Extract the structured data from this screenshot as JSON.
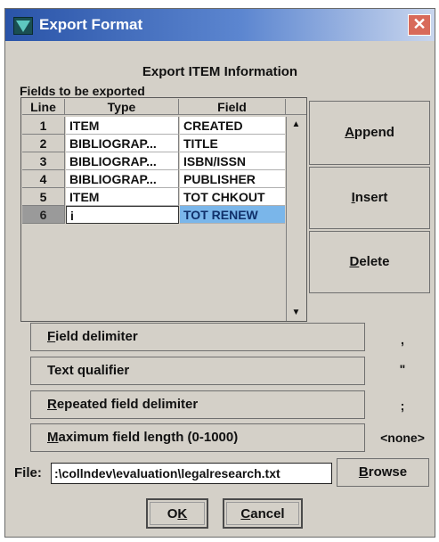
{
  "window": {
    "title": "Export Format",
    "close_glyph": "✕",
    "colors": {
      "titlebar_start": "#2a54a8",
      "titlebar_end": "#c9d6ee",
      "body": "#d4d0c8"
    }
  },
  "heading": "Export ITEM Information",
  "fields_label": "Fields to be exported",
  "table": {
    "columns": [
      "Line",
      "Type",
      "Field"
    ],
    "rows": [
      {
        "line": "1",
        "type": "ITEM",
        "field": "CREATED"
      },
      {
        "line": "2",
        "type": "BIBLIOGRAP...",
        "field": "TITLE"
      },
      {
        "line": "3",
        "type": "BIBLIOGRAP...",
        "field": "ISBN/ISSN"
      },
      {
        "line": "4",
        "type": "BIBLIOGRAP...",
        "field": "PUBLISHER"
      },
      {
        "line": "5",
        "type": "ITEM",
        "field": "TOT CHKOUT"
      },
      {
        "line": "6",
        "type": "i",
        "field": "TOT RENEW"
      }
    ],
    "selected_line": "6"
  },
  "side_buttons": {
    "append": {
      "first": "A",
      "rest": "ppend"
    },
    "insert": {
      "first": "I",
      "rest": "nsert"
    },
    "delete": {
      "first": "D",
      "rest": "elete"
    }
  },
  "options": [
    {
      "label_first": "F",
      "label_rest": "ield delimiter",
      "value": ","
    },
    {
      "label_first": "",
      "label_rest": "Text qualifier",
      "value": "\""
    },
    {
      "label_first": "R",
      "label_rest": "epeated field delimiter",
      "value": ";"
    },
    {
      "label_first": "M",
      "label_rest": "aximum field length (0-1000)",
      "value": "<none>"
    }
  ],
  "file": {
    "label": "File:",
    "value": ":\\collndev\\evaluation\\legalresearch.txt",
    "browse_first": "B",
    "browse_rest": "rowse"
  },
  "buttons": {
    "ok_first": "O",
    "ok_underlined": "K",
    "cancel_first": "C",
    "cancel_rest": "ancel"
  },
  "icons": {
    "app": "app-logo-icon",
    "close": "close-icon",
    "scroll_up": "scroll-up-arrow-icon",
    "scroll_down": "scroll-down-arrow-icon"
  }
}
